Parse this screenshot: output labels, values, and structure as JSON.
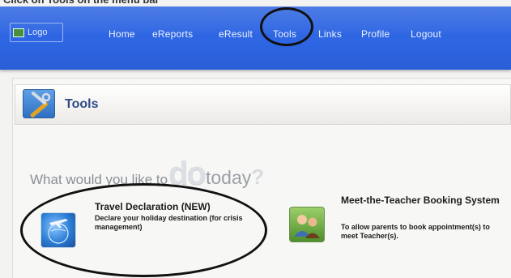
{
  "instruction": "Click on Tools on the menu bar",
  "nav": {
    "logo_label": "Logo",
    "items": [
      "Home",
      "eReports",
      "eResult",
      "Tools",
      "Links",
      "Profile",
      "Logout"
    ]
  },
  "section": {
    "title": "Tools"
  },
  "tagline": {
    "before": "What would you like to",
    "emphasis": "do",
    "after": "today",
    "mark": "?"
  },
  "cards": [
    {
      "title": "Travel Declaration (NEW)",
      "description": "Declare your holiday destination (for crisis management)",
      "icon": "globe-airplane-icon"
    },
    {
      "title": "Meet-the-Teacher Booking System",
      "description": "To allow parents to book appointment(s) to meet Teacher(s).",
      "icon": "people-icon"
    }
  ],
  "colors": {
    "nav_bar": "#2e66e3",
    "nav_text": "#eef3ff",
    "section_title": "#2f4a8a",
    "highlight_ring": "#111111"
  }
}
